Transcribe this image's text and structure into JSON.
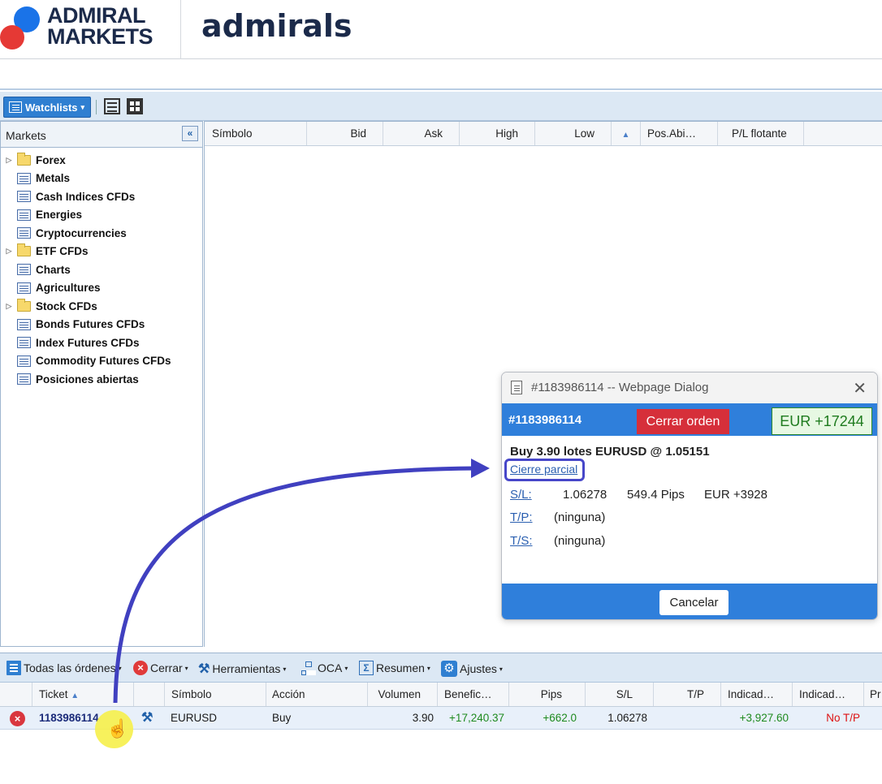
{
  "header": {
    "logo1_line1": "ADMIRAL",
    "logo1_line2": "MARKETS",
    "logo2": "admirals"
  },
  "toolbar": {
    "watchlists_label": "Watchlists",
    "icons": [
      "list-view-icon",
      "grid-view-icon"
    ]
  },
  "markets": {
    "title": "Markets",
    "collapse_glyph": "«",
    "items": [
      {
        "label": "Forex",
        "type": "folder",
        "expandable": true
      },
      {
        "label": "Metals",
        "type": "list",
        "expandable": false
      },
      {
        "label": "Cash Indices CFDs",
        "type": "list",
        "expandable": false
      },
      {
        "label": "Energies",
        "type": "list",
        "expandable": false
      },
      {
        "label": "Cryptocurrencies",
        "type": "list",
        "expandable": false
      },
      {
        "label": "ETF CFDs",
        "type": "folder",
        "expandable": true
      },
      {
        "label": "Charts",
        "type": "list",
        "expandable": false
      },
      {
        "label": "Agricultures",
        "type": "list",
        "expandable": false
      },
      {
        "label": "Stock CFDs",
        "type": "folder",
        "expandable": true
      },
      {
        "label": "Bonds Futures CFDs",
        "type": "list",
        "expandable": false
      },
      {
        "label": "Index Futures CFDs",
        "type": "list",
        "expandable": false
      },
      {
        "label": "Commodity Futures CFDs",
        "type": "list",
        "expandable": false
      },
      {
        "label": "Posiciones abiertas",
        "type": "list",
        "expandable": false
      }
    ]
  },
  "watch_grid": {
    "columns": [
      "Símbolo",
      "Bid",
      "Ask",
      "High",
      "Low",
      "",
      "Pos.Abi…",
      "P/L flotante"
    ]
  },
  "orders": {
    "toolbar": {
      "all_orders": "Todas las órdenes",
      "close": "Cerrar",
      "tools": "Herramientas",
      "oca": "OCA",
      "summary": "Resumen",
      "settings": "Ajustes"
    },
    "columns": [
      "Ticket",
      "",
      "Símbolo",
      "Acción",
      "Volumen",
      "Benefic…",
      "Pips",
      "S/L",
      "T/P",
      "Indicad…",
      "Indicad…",
      "Pr"
    ],
    "rows": [
      {
        "ticket": "1183986114",
        "symbol": "EURUSD",
        "action": "Buy",
        "volume": "3.90",
        "profit": "+17,240.37",
        "pips": "+662.0",
        "sl": "1.06278",
        "tp": "",
        "ind1": "+3,927.60",
        "ind2": "No T/P"
      }
    ]
  },
  "dialog": {
    "title": "#1183986114 -- Webpage Dialog",
    "ticket": "#1183986114",
    "close_order": "Cerrar orden",
    "pl": "EUR +17244",
    "summary": "Buy 3.90 lotes EURUSD @ 1.05151",
    "partial_close": "Cierre parcial",
    "sl_label": "S/L:",
    "sl_value": "1.06278",
    "sl_pips": "549.4 Pips",
    "sl_money": "EUR +3928",
    "tp_label": "T/P:",
    "tp_value": "(ninguna)",
    "ts_label": "T/S:",
    "ts_value": "(ninguna)",
    "cancel": "Cancelar"
  },
  "colors": {
    "accent_blue": "#2f7fdb",
    "close_red": "#d62f3a",
    "profit_green": "#1e8a1e",
    "annotation_arrow": "#4040c0",
    "cursor_highlight": "#f6f04a"
  }
}
